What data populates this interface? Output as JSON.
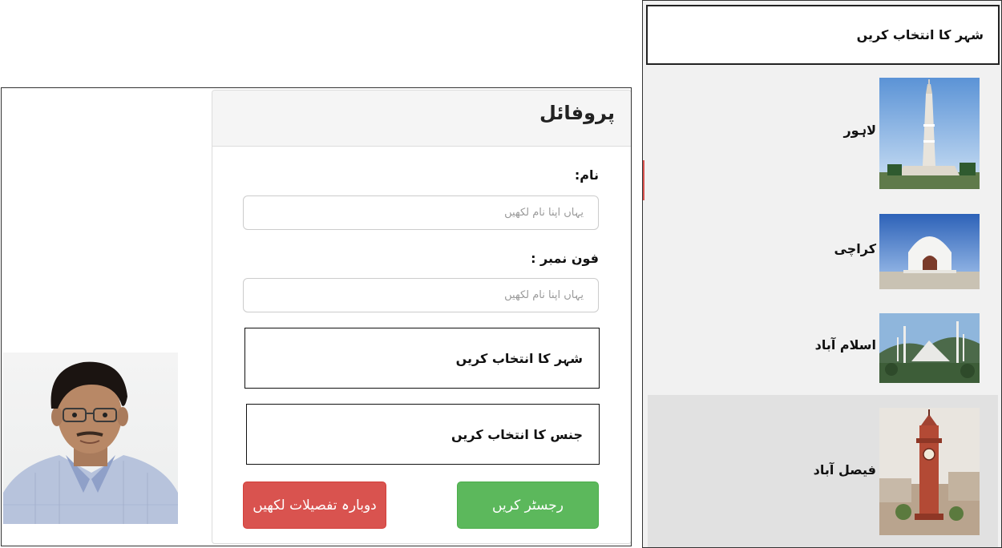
{
  "profile": {
    "title": "پروفائل",
    "name_label": "نام:",
    "name_placeholder": "یہاں اپنا نام لکھیں",
    "phone_label": "فون نمبر :",
    "phone_placeholder": "یہاں اپنا نام لکھیں",
    "city_select": "شہر کا انتخاب کریں",
    "gender_select": "جنس کا انتخاب کریں",
    "register_button": "رجسٹر کریں",
    "reset_button": "دوبارہ تفصیلات لکھیں",
    "colors": {
      "register": "#5cb85c",
      "reset": "#d9534f"
    }
  },
  "city_picker": {
    "header": "شہر کا انتخاب کریں",
    "cities": [
      {
        "name": "لاہور",
        "icon": "minar-e-pakistan-image"
      },
      {
        "name": "کراچی",
        "icon": "mazar-e-quaid-image"
      },
      {
        "name": "اسلام آباد",
        "icon": "faisal-mosque-image"
      },
      {
        "name": "فیصل آباد",
        "icon": "clock-tower-image",
        "selected": true
      }
    ]
  }
}
